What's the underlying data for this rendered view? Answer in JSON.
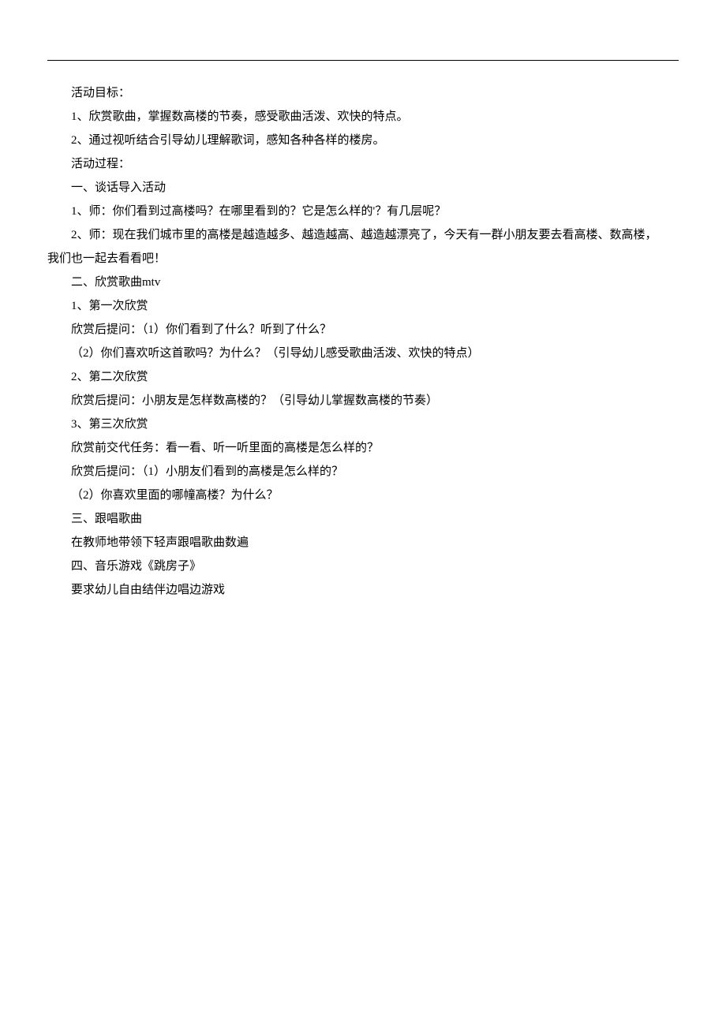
{
  "lines": [
    "活动目标：",
    "1、欣赏歌曲，掌握数高楼的节奏，感受歌曲活泼、欢快的特点。",
    "2、通过视听结合引导幼儿理解歌词，感知各种各样的楼房。",
    "活动过程：",
    "一、谈话导入活动",
    "1、师：你们看到过高楼吗？在哪里看到的？它是怎么样的'？有几层呢？",
    "2、师：现在我们城市里的高楼是越造越多、越造越高、越造越漂亮了，今天有一群小朋友要去看高楼、数高楼，",
    "我们也一起去看看吧！",
    "二、欣赏歌曲mtv",
    "1、第一次欣赏",
    "欣赏后提问：（1）你们看到了什么？听到了什么？",
    "（2）你们喜欢听这首歌吗？为什么？（引导幼儿感受歌曲活泼、欢快的特点）",
    "2、第二次欣赏",
    "欣赏后提问：小朋友是怎样数高楼的？（引导幼儿掌握数高楼的节奏）",
    "3、第三次欣赏",
    "欣赏前交代任务：看一看、听一听里面的高楼是怎么样的？",
    "欣赏后提问：（1）小朋友们看到的高楼是怎么样的？",
    "（2）你喜欢里面的哪幢高楼？为什么？",
    "三、跟唱歌曲",
    "在教师地带领下轻声跟唱歌曲数遍",
    "四、音乐游戏《跳房子》",
    "要求幼儿自由结伴边唱边游戏"
  ],
  "noIndentIndices": [
    7
  ]
}
